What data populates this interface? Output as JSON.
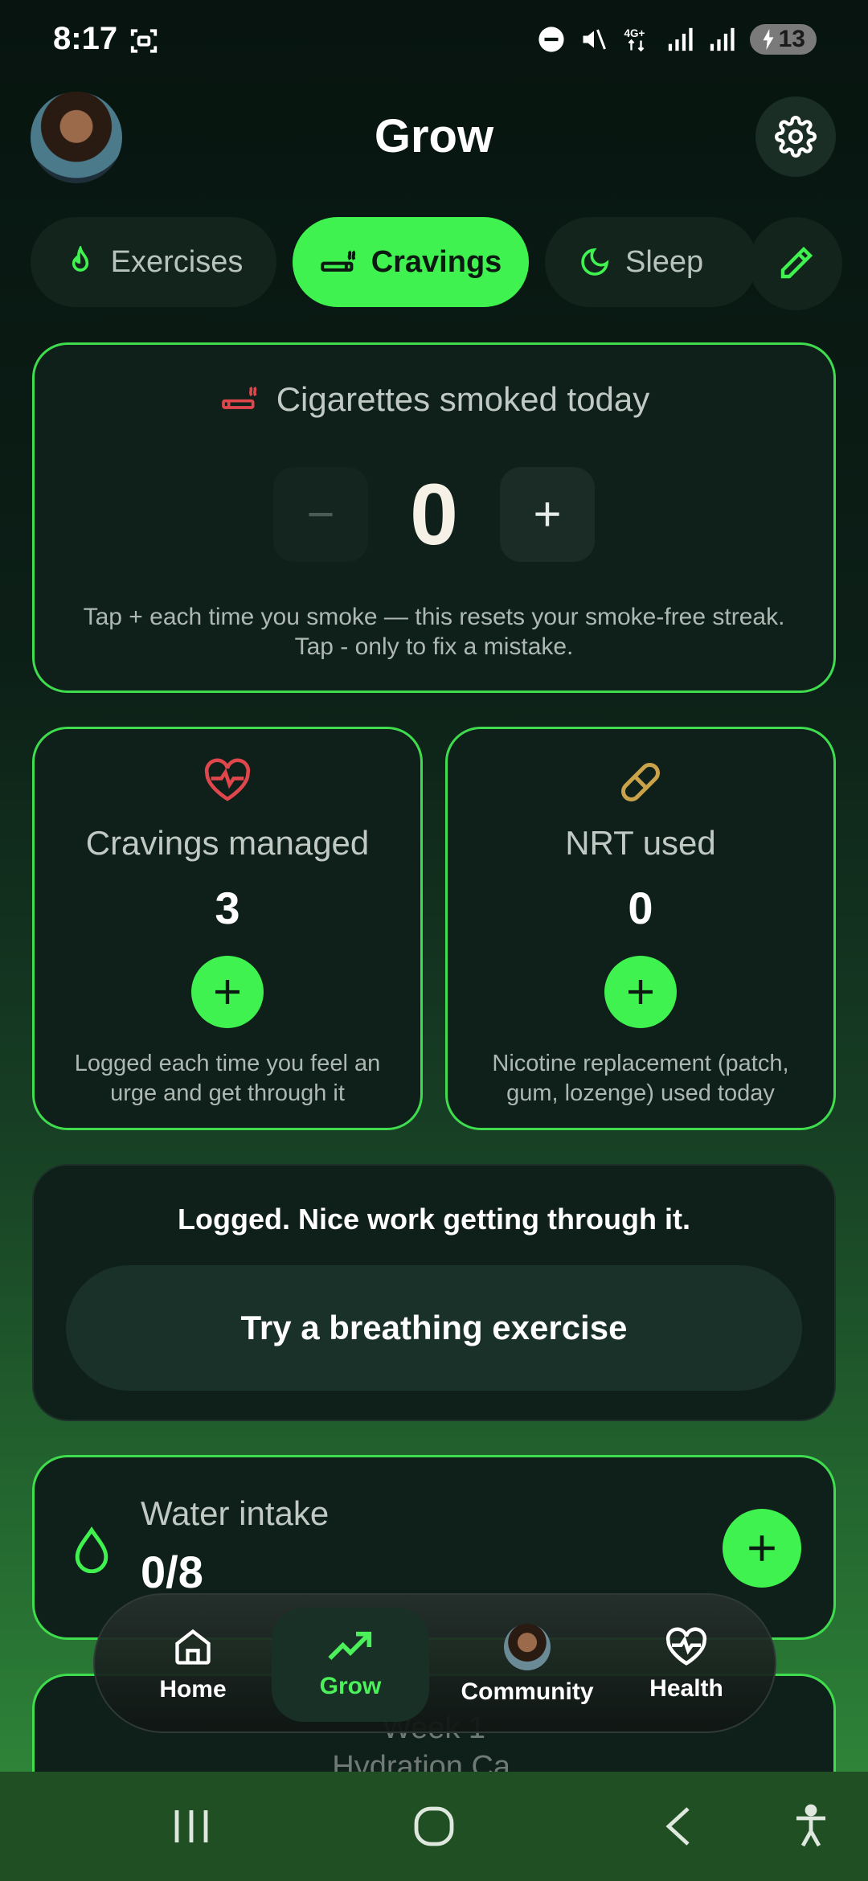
{
  "status_bar": {
    "time": "8:17",
    "battery": "13"
  },
  "header": {
    "title": "Grow"
  },
  "tabs": [
    {
      "label": "Exercises",
      "icon": "flame-icon"
    },
    {
      "label": "Cravings",
      "icon": "cigarette-icon",
      "active": true
    },
    {
      "label": "Sleep",
      "icon": "moon-icon"
    }
  ],
  "cigarettes": {
    "title": "Cigarettes smoked today",
    "count": "0",
    "minus": "−",
    "plus": "+",
    "help_line1": "Tap + each time you smoke — this resets your smoke-free streak.",
    "help_line2": "Tap - only to fix a mistake."
  },
  "cravings_managed": {
    "title": "Cravings managed",
    "value": "3",
    "help": "Logged each time you feel an urge and get through it"
  },
  "nrt": {
    "title": "NRT used",
    "value": "0",
    "help": "Nicotine replacement (patch, gum, lozenge) used today"
  },
  "logged": {
    "message": "Logged. Nice work getting through it.",
    "button": "Try a breathing exercise"
  },
  "water": {
    "label": "Water intake",
    "value": "0/8"
  },
  "week": {
    "title": "Week 1",
    "subtitle": "Hydration Ca..."
  },
  "bottom_nav": [
    {
      "label": "Home",
      "icon": "home-icon"
    },
    {
      "label": "Grow",
      "icon": "trending-up-icon",
      "active": true
    },
    {
      "label": "Community",
      "icon": "avatar"
    },
    {
      "label": "Health",
      "icon": "heart-pulse-icon"
    }
  ],
  "colors": {
    "accent": "#3ff24f",
    "card_border": "#3fdc4e",
    "card_bg": "#0f1f1a",
    "red": "#e0474c",
    "gold": "#c9a24a"
  }
}
